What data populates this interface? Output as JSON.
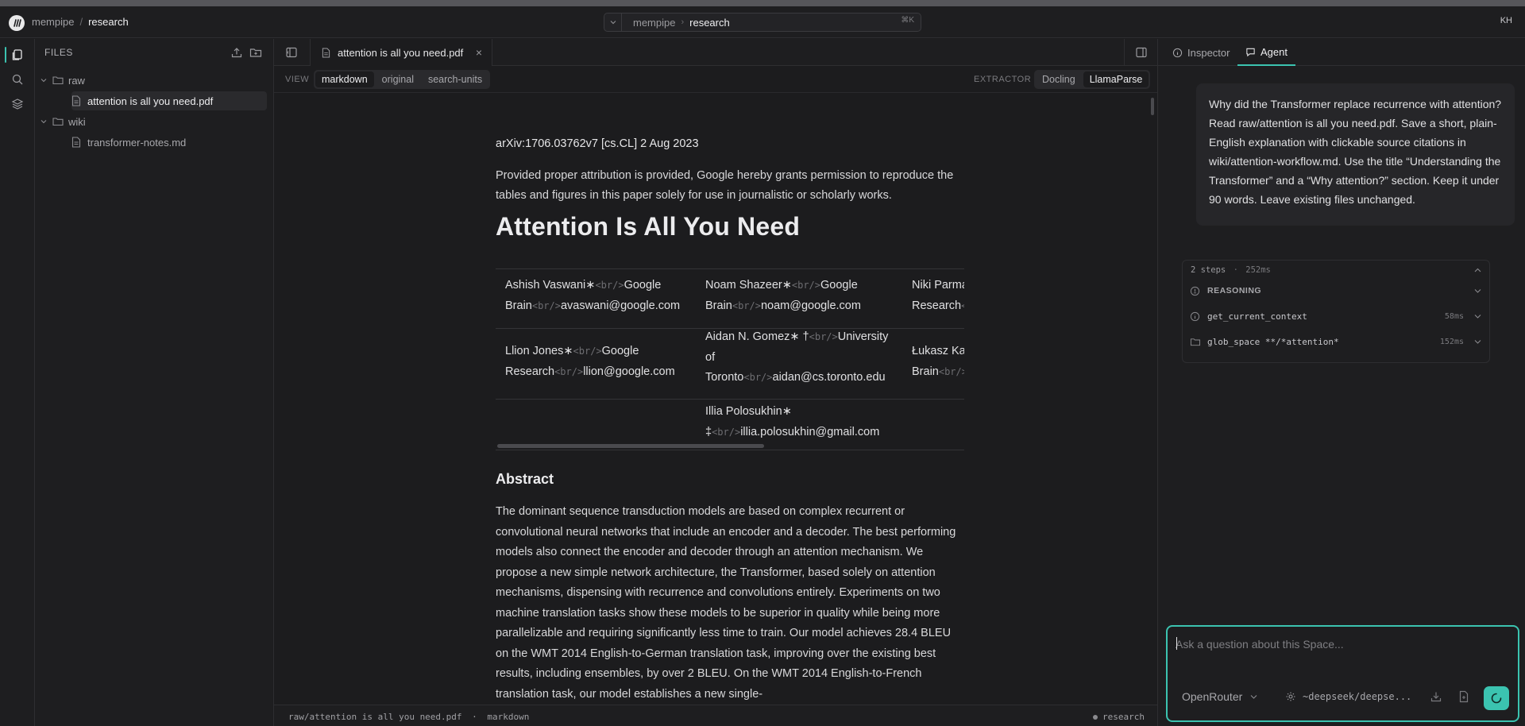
{
  "topbar": {
    "breadcrumb": [
      "mempipe",
      "research"
    ],
    "command": {
      "parts": [
        "mempipe",
        "research"
      ],
      "shortcut": "⌘K"
    },
    "avatar": "KH"
  },
  "files": {
    "title": "FILES",
    "tree": [
      {
        "type": "folder",
        "label": "raw"
      },
      {
        "type": "file",
        "label": "attention is all you need.pdf",
        "selected": true
      },
      {
        "type": "folder",
        "label": "wiki"
      },
      {
        "type": "file",
        "label": "transformer-notes.md"
      }
    ]
  },
  "tab": {
    "label": "attention is all you need.pdf",
    "close": "×"
  },
  "viewbar": {
    "view_label": "VIEW",
    "views": [
      "markdown",
      "original",
      "search-units"
    ],
    "active_view": "markdown",
    "extractor_label": "EXTRACTOR",
    "extractors": [
      "Docling",
      "LlamaParse"
    ],
    "active_extractor": "LlamaParse"
  },
  "document": {
    "arxiv": "arXiv:1706.03762v7 [cs.CL] 2 Aug 2023",
    "permission": "Provided proper attribution is provided, Google hereby grants permission to reproduce the tables and figures in this paper solely for use in journalistic or scholarly works.",
    "title": "Attention Is All You Need",
    "br_tag": "<br/>",
    "authors": {
      "r1c1": {
        "a": "Ashish Vaswani∗",
        "b": "Google",
        "c": "Brain",
        "d": "avaswani@google.com"
      },
      "r1c2": {
        "a": "Noam Shazeer∗",
        "b": "Google",
        "c": "Brain",
        "d": "noam@google.com"
      },
      "r1c3": {
        "a": "Niki Parma",
        "b": "Research"
      },
      "r2c1": {
        "a": "Llion Jones∗",
        "b": "Google",
        "c": "Research",
        "d": "llion@google.com"
      },
      "r2c2": {
        "a": "Aidan N. Gomez∗ †",
        "b": "University",
        "c": "of",
        "d": "Toronto",
        "e": "aidan@cs.toronto.edu"
      },
      "r2c3": {
        "a": "Łukasz Ka",
        "b": "Brain"
      },
      "r3c2": {
        "a": "Illia Polosukhin∗",
        "b": "‡",
        "c": "illia.polosukhin@gmail.com"
      }
    },
    "abstract_heading": "Abstract",
    "abstract": "The dominant sequence transduction models are based on complex recurrent or convolutional neural networks that include an encoder and a decoder. The best performing models also connect the encoder and decoder through an attention mechanism. We propose a new simple network architecture, the Transformer, based solely on attention mechanisms, dispensing with recurrence and convolutions entirely. Experiments on two machine translation tasks show these models to be superior in quality while being more parallelizable and requiring significantly less time to train. Our model achieves 28.4 BLEU on the WMT 2014 English-to-German translation task, improving over the existing best results, including ensembles, by over 2 BLEU. On the WMT 2014 English-to-French translation task, our model establishes a new single-"
  },
  "statusbar": {
    "path": "raw/attention is all you need.pdf",
    "sep": "·",
    "mode": "markdown",
    "space": "research"
  },
  "right_panel": {
    "tabs": [
      "Inspector",
      "Agent"
    ],
    "active_tab": "Agent",
    "user_message": "Why did the Transformer replace recurrence with attention? Read raw/attention is all you need.pdf. Save a short, plain-English explanation with clickable source citations in wiki/attention-workflow.md. Use the title “Understanding the Transformer” and a “Why attention?” section. Keep it under 90 words. Leave existing files unchanged.",
    "steps": {
      "summary": "2 steps",
      "dot": "·",
      "duration": "252ms",
      "items": [
        {
          "label": "REASONING",
          "time": ""
        },
        {
          "label": "get_current_context",
          "time": "58ms"
        },
        {
          "label": "glob_space **/*attention*",
          "time": "152ms"
        }
      ]
    },
    "composer": {
      "placeholder": "Ask a question about this Space...",
      "provider": "OpenRouter",
      "model": "~deepseek/deepse..."
    }
  },
  "colors": {
    "accent": "#3bc3b0",
    "background": "#1c1c1e",
    "panel": "#1e1e20"
  }
}
